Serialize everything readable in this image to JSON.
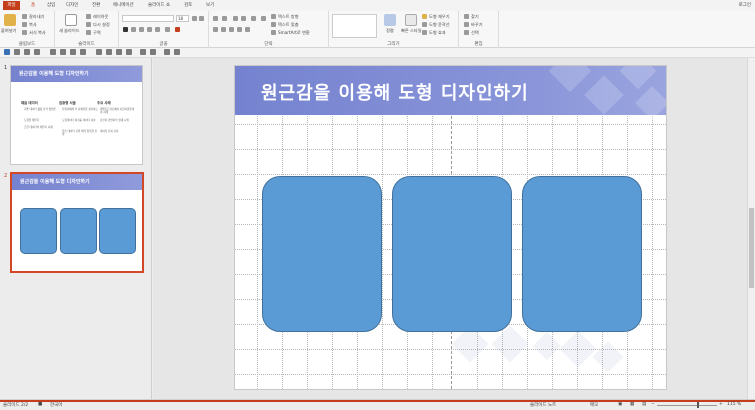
{
  "ribbon_tabs": [
    "파일",
    "홈",
    "삽입",
    "디자인",
    "전환",
    "애니메이션",
    "슬라이드 쇼",
    "검토",
    "보기"
  ],
  "active_tab": "홈",
  "login": "로그인",
  "ribbon": {
    "paste": "붙여넣기",
    "cut": "잘라내기",
    "copy": "복사",
    "format_painter": "서식 복사",
    "new_slide": "새 슬라이드",
    "layout": "레이아웃",
    "reset": "다시 설정",
    "section": "구역",
    "text_direction": "텍스트 방향",
    "align_text": "텍스트 맞춤",
    "smartart": "SmartArt로 변환",
    "arrange": "정렬",
    "quick_styles": "빠른 스타일",
    "shape_fill": "도형 채우기",
    "shape_outline": "도형 윤곽선",
    "shape_effects": "도형 효과",
    "find": "찾기",
    "replace": "바꾸기",
    "select": "선택",
    "font_size": "18",
    "groups": {
      "clipboard": "클립보드",
      "slides": "슬라이드",
      "font": "글꼴",
      "paragraph": "단락",
      "drawing": "그리기",
      "editing": "편집"
    }
  },
  "thumbnails": [
    {
      "number": "1",
      "title": "원근감을 이용해 도형 디자인하기",
      "columns": [
        {
          "head": "채움 데이터",
          "bullets": [
            "기존 데이터 활용 분석 방법론",
            "도형을 채우기",
            "흔한 데이터의 채우기 사례"
          ]
        },
        {
          "head": "집중형 서술",
          "bullets": [
            "진필자에게 각 사례만을 정리하는",
            "도형데이터 처리를 데이터 서술",
            "학습 데이터 기반 해석 항목을 진행"
          ]
        },
        {
          "head": "주요 사례",
          "bullets": [
            "개별모든자료에서 다한사람들데이 사례",
            "요인이 관련지식 설계 시행",
            "데이터 신뢰 요지"
          ]
        }
      ]
    },
    {
      "number": "2",
      "title": "원근감을 이용해 도형 디자인하기"
    }
  ],
  "slide": {
    "title": "원근감을 이용해 도형 디자인하기",
    "shape_count": 3
  },
  "status": {
    "slide_info": "슬라이드 2/2",
    "language": "한국어",
    "notes": "슬라이드 노트",
    "comments": "메모",
    "zoom": "115 %"
  },
  "colors": {
    "accent": "#c43e1c",
    "title_bar": "#7582cf",
    "shape_fill": "#5b9bd5",
    "shape_outline": "#41719c"
  }
}
